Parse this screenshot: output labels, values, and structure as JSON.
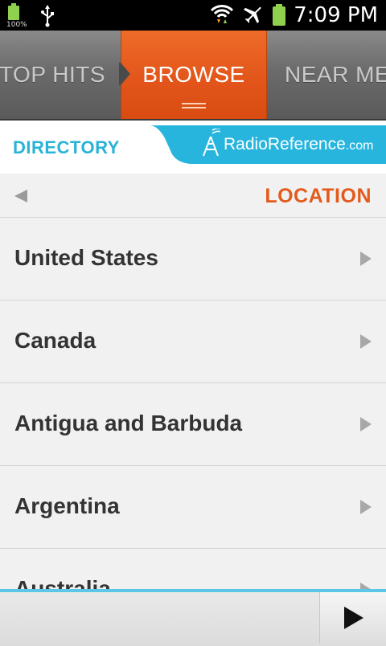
{
  "status_bar": {
    "battery_small_label": "100%",
    "time": "7:09 PM"
  },
  "tabs": [
    {
      "label": "TOP HITS",
      "active": false
    },
    {
      "label": "BROWSE",
      "active": true
    },
    {
      "label": "NEAR ME",
      "active": false
    }
  ],
  "directory": {
    "title": "DIRECTORY",
    "logo_text": "RadioReference",
    "logo_suffix": ".com"
  },
  "location": {
    "title": "LOCATION"
  },
  "list": {
    "items": [
      {
        "label": "United States"
      },
      {
        "label": "Canada"
      },
      {
        "label": "Antigua and Barbuda"
      },
      {
        "label": "Argentina"
      },
      {
        "label": "Australia"
      }
    ]
  },
  "colors": {
    "accent_orange": "#e35b1c",
    "accent_blue": "#28b3d8"
  },
  "icons": {
    "usb": "usb-icon",
    "wifi": "wifi-icon",
    "airplane": "airplane-mode-icon",
    "battery": "battery-icon",
    "back": "back-arrow-icon",
    "chevron": "chevron-right-icon",
    "play": "play-icon",
    "tower": "radio-tower-icon"
  }
}
